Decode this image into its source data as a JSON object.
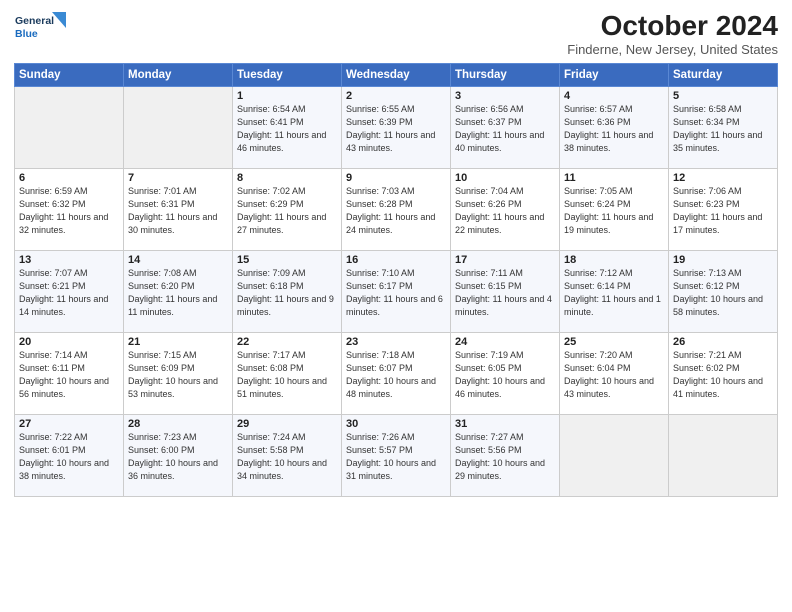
{
  "logo": {
    "line1": "General",
    "line2": "Blue"
  },
  "title": "October 2024",
  "subtitle": "Finderne, New Jersey, United States",
  "weekdays": [
    "Sunday",
    "Monday",
    "Tuesday",
    "Wednesday",
    "Thursday",
    "Friday",
    "Saturday"
  ],
  "weeks": [
    [
      {
        "day": "",
        "info": ""
      },
      {
        "day": "",
        "info": ""
      },
      {
        "day": "1",
        "info": "Sunrise: 6:54 AM\nSunset: 6:41 PM\nDaylight: 11 hours and 46 minutes."
      },
      {
        "day": "2",
        "info": "Sunrise: 6:55 AM\nSunset: 6:39 PM\nDaylight: 11 hours and 43 minutes."
      },
      {
        "day": "3",
        "info": "Sunrise: 6:56 AM\nSunset: 6:37 PM\nDaylight: 11 hours and 40 minutes."
      },
      {
        "day": "4",
        "info": "Sunrise: 6:57 AM\nSunset: 6:36 PM\nDaylight: 11 hours and 38 minutes."
      },
      {
        "day": "5",
        "info": "Sunrise: 6:58 AM\nSunset: 6:34 PM\nDaylight: 11 hours and 35 minutes."
      }
    ],
    [
      {
        "day": "6",
        "info": "Sunrise: 6:59 AM\nSunset: 6:32 PM\nDaylight: 11 hours and 32 minutes."
      },
      {
        "day": "7",
        "info": "Sunrise: 7:01 AM\nSunset: 6:31 PM\nDaylight: 11 hours and 30 minutes."
      },
      {
        "day": "8",
        "info": "Sunrise: 7:02 AM\nSunset: 6:29 PM\nDaylight: 11 hours and 27 minutes."
      },
      {
        "day": "9",
        "info": "Sunrise: 7:03 AM\nSunset: 6:28 PM\nDaylight: 11 hours and 24 minutes."
      },
      {
        "day": "10",
        "info": "Sunrise: 7:04 AM\nSunset: 6:26 PM\nDaylight: 11 hours and 22 minutes."
      },
      {
        "day": "11",
        "info": "Sunrise: 7:05 AM\nSunset: 6:24 PM\nDaylight: 11 hours and 19 minutes."
      },
      {
        "day": "12",
        "info": "Sunrise: 7:06 AM\nSunset: 6:23 PM\nDaylight: 11 hours and 17 minutes."
      }
    ],
    [
      {
        "day": "13",
        "info": "Sunrise: 7:07 AM\nSunset: 6:21 PM\nDaylight: 11 hours and 14 minutes."
      },
      {
        "day": "14",
        "info": "Sunrise: 7:08 AM\nSunset: 6:20 PM\nDaylight: 11 hours and 11 minutes."
      },
      {
        "day": "15",
        "info": "Sunrise: 7:09 AM\nSunset: 6:18 PM\nDaylight: 11 hours and 9 minutes."
      },
      {
        "day": "16",
        "info": "Sunrise: 7:10 AM\nSunset: 6:17 PM\nDaylight: 11 hours and 6 minutes."
      },
      {
        "day": "17",
        "info": "Sunrise: 7:11 AM\nSunset: 6:15 PM\nDaylight: 11 hours and 4 minutes."
      },
      {
        "day": "18",
        "info": "Sunrise: 7:12 AM\nSunset: 6:14 PM\nDaylight: 11 hours and 1 minute."
      },
      {
        "day": "19",
        "info": "Sunrise: 7:13 AM\nSunset: 6:12 PM\nDaylight: 10 hours and 58 minutes."
      }
    ],
    [
      {
        "day": "20",
        "info": "Sunrise: 7:14 AM\nSunset: 6:11 PM\nDaylight: 10 hours and 56 minutes."
      },
      {
        "day": "21",
        "info": "Sunrise: 7:15 AM\nSunset: 6:09 PM\nDaylight: 10 hours and 53 minutes."
      },
      {
        "day": "22",
        "info": "Sunrise: 7:17 AM\nSunset: 6:08 PM\nDaylight: 10 hours and 51 minutes."
      },
      {
        "day": "23",
        "info": "Sunrise: 7:18 AM\nSunset: 6:07 PM\nDaylight: 10 hours and 48 minutes."
      },
      {
        "day": "24",
        "info": "Sunrise: 7:19 AM\nSunset: 6:05 PM\nDaylight: 10 hours and 46 minutes."
      },
      {
        "day": "25",
        "info": "Sunrise: 7:20 AM\nSunset: 6:04 PM\nDaylight: 10 hours and 43 minutes."
      },
      {
        "day": "26",
        "info": "Sunrise: 7:21 AM\nSunset: 6:02 PM\nDaylight: 10 hours and 41 minutes."
      }
    ],
    [
      {
        "day": "27",
        "info": "Sunrise: 7:22 AM\nSunset: 6:01 PM\nDaylight: 10 hours and 38 minutes."
      },
      {
        "day": "28",
        "info": "Sunrise: 7:23 AM\nSunset: 6:00 PM\nDaylight: 10 hours and 36 minutes."
      },
      {
        "day": "29",
        "info": "Sunrise: 7:24 AM\nSunset: 5:58 PM\nDaylight: 10 hours and 34 minutes."
      },
      {
        "day": "30",
        "info": "Sunrise: 7:26 AM\nSunset: 5:57 PM\nDaylight: 10 hours and 31 minutes."
      },
      {
        "day": "31",
        "info": "Sunrise: 7:27 AM\nSunset: 5:56 PM\nDaylight: 10 hours and 29 minutes."
      },
      {
        "day": "",
        "info": ""
      },
      {
        "day": "",
        "info": ""
      }
    ]
  ]
}
